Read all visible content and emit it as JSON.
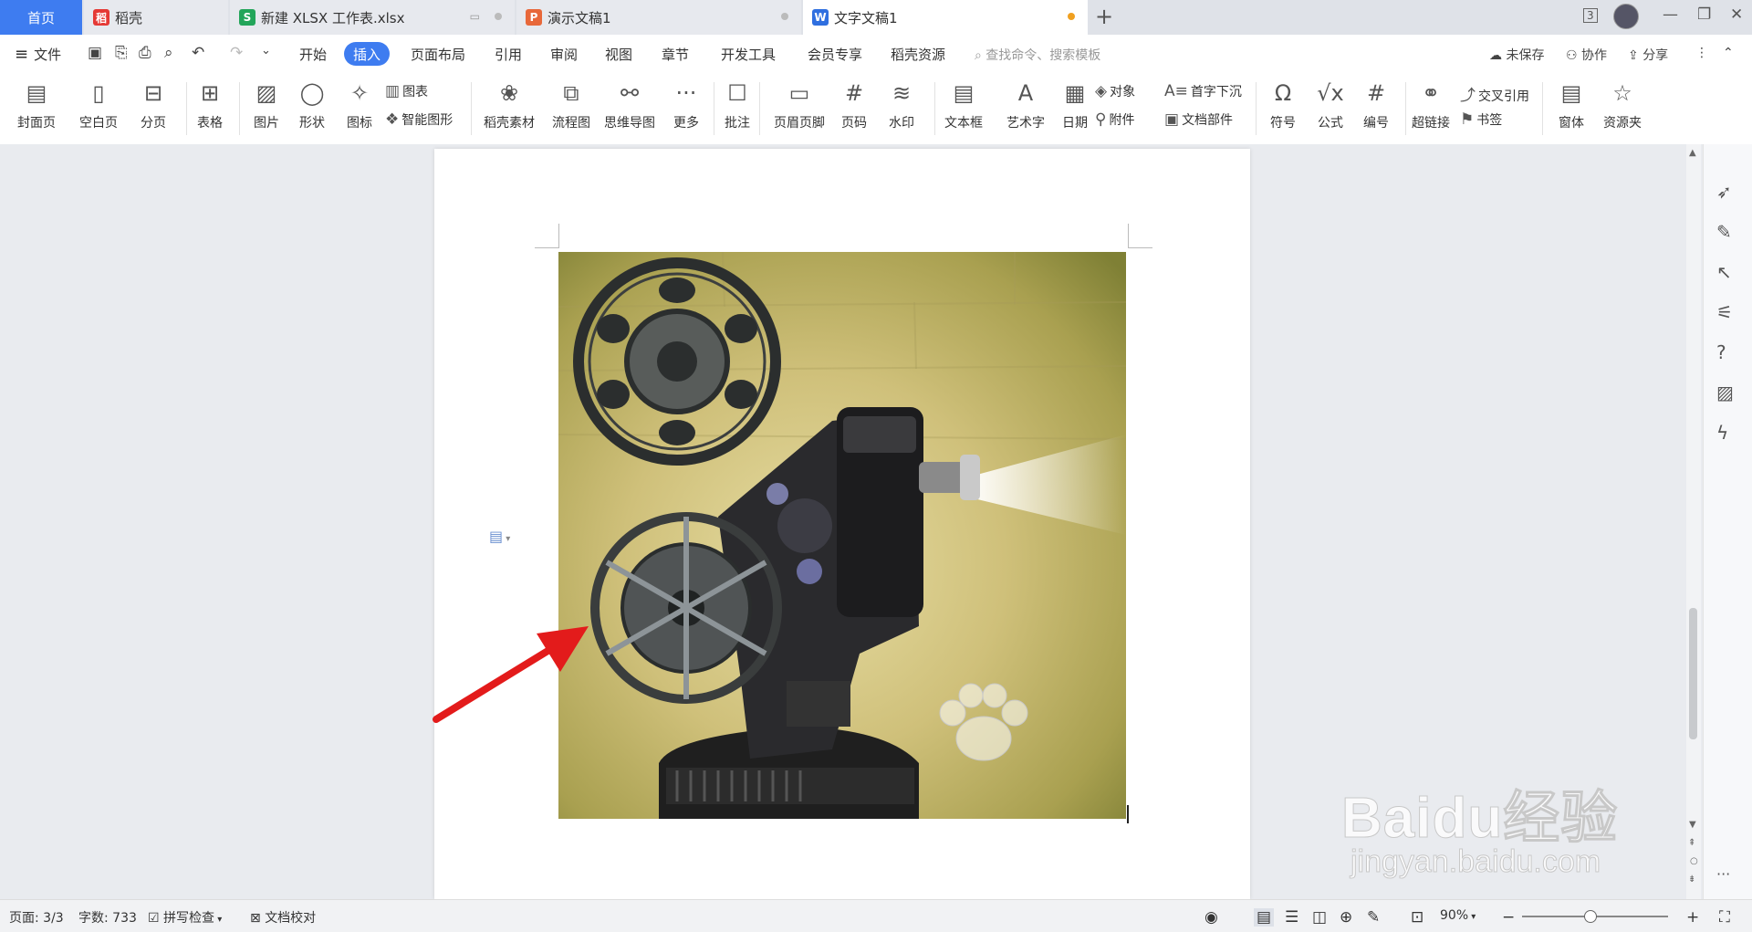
{
  "tabs": {
    "home": "首页",
    "daoke": "稻壳",
    "xlsx": "新建 XLSX 工作表.xlsx",
    "ppt": "演示文稿1",
    "doc": "文字文稿1",
    "count_badge": "3"
  },
  "menu": {
    "file": "文件",
    "items": [
      "开始",
      "插入",
      "页面布局",
      "引用",
      "审阅",
      "视图",
      "章节",
      "开发工具",
      "会员专享",
      "稻壳资源"
    ],
    "active": "插入",
    "search_placeholder": "查找命令、搜索模板",
    "unsaved": "未保存",
    "collab": "协作",
    "share": "分享"
  },
  "ribbon": {
    "cover": "封面页",
    "blank": "空白页",
    "pagebreak": "分页",
    "table": "表格",
    "picture": "图片",
    "shape": "形状",
    "icon": "图标",
    "chart": "图表",
    "smartart": "智能图形",
    "material": "稻壳素材",
    "flowchart": "流程图",
    "mindmap": "思维导图",
    "more": "更多",
    "comment": "批注",
    "headerfooter": "页眉页脚",
    "pagenum": "页码",
    "watermark": "水印",
    "textbox": "文本框",
    "wordart": "艺术字",
    "date": "日期",
    "object": "对象",
    "attachment": "附件",
    "dropcap": "首字下沉",
    "docparts": "文档部件",
    "symbol": "符号",
    "formula": "公式",
    "numbering": "编号",
    "hyperlink": "超链接",
    "crossref": "交叉引用",
    "bookmark": "书签",
    "window": "窗体",
    "resources": "资源夹"
  },
  "status": {
    "page": "页面: 3/3",
    "words": "字数: 733",
    "spellcheck": "拼写检查",
    "proof": "文档校对",
    "zoom": "90%"
  },
  "watermark": {
    "brand": "Baidu经验",
    "url": "jingyan.baidu.com"
  },
  "colors": {
    "accent": "#3e7cf0",
    "arrow": "#e31b1b"
  }
}
